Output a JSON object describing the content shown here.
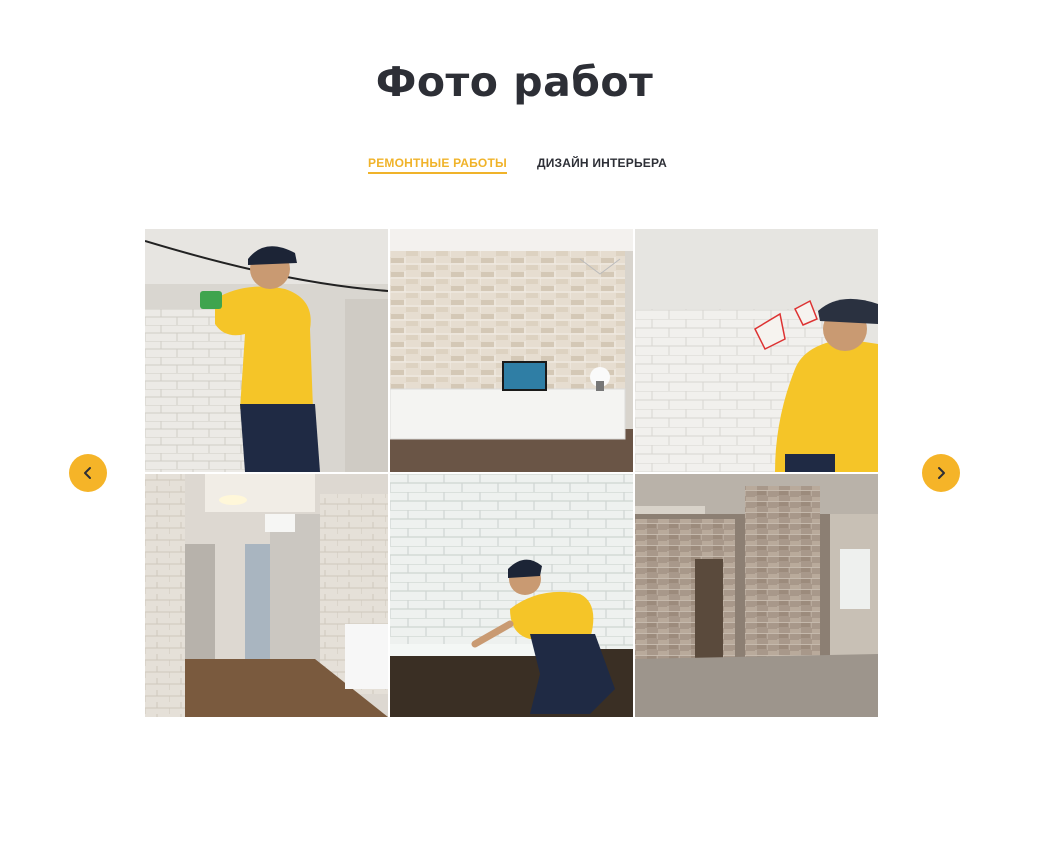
{
  "section": {
    "title": "Фото работ"
  },
  "tabs": [
    {
      "label": "РЕМОНТНЫЕ РАБОТЫ",
      "active": true
    },
    {
      "label": "ДИЗАЙН ИНТЕРЬЕРА",
      "active": false
    }
  ],
  "gallery": {
    "photos": [
      {
        "subject": "worker in yellow shirt laying white brick tiles on wall"
      },
      {
        "subject": "room with light brick wall, white TV cabinet and chandelier"
      },
      {
        "subject": "worker in gloves placing white brick panels"
      },
      {
        "subject": "hallway with brick accent wall and open door"
      },
      {
        "subject": "worker kneeling, installing baseboard by white brick wall"
      },
      {
        "subject": "unfinished room with exposed brick column"
      }
    ]
  },
  "navigation": {
    "prev_icon": "chevron-left-icon",
    "next_icon": "chevron-right-icon"
  },
  "colors": {
    "accent": "#f5b428",
    "text": "#2d2f36",
    "background": "#ffffff"
  }
}
